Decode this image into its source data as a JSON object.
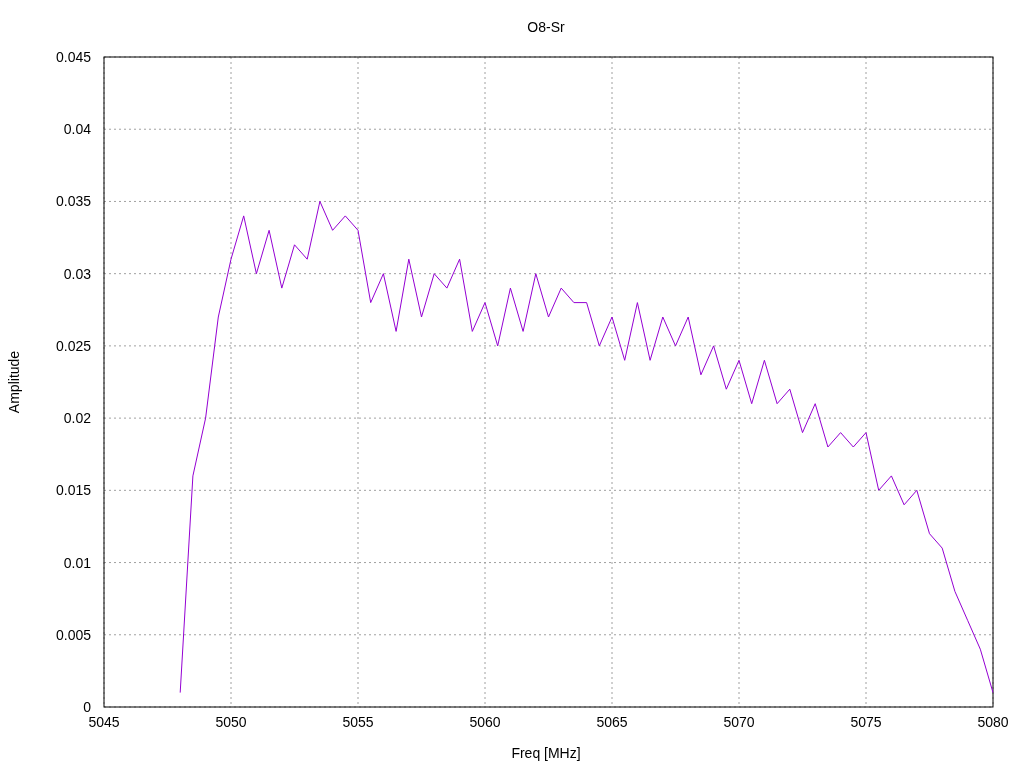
{
  "plot": {
    "chart_data": {
      "type": "line",
      "title": "O8-Sr",
      "xlabel": "Freq [MHz]",
      "ylabel": "Amplitude",
      "grid": true,
      "xlim": [
        5045,
        5080
      ],
      "ylim": [
        0,
        0.045
      ],
      "xticks": [
        5045,
        5050,
        5055,
        5060,
        5065,
        5070,
        5075,
        5080
      ],
      "yticks": [
        0,
        0.005,
        0.01,
        0.015,
        0.02,
        0.025,
        0.03,
        0.035,
        0.04,
        0.045
      ],
      "x": [
        5048,
        5048.5,
        5049,
        5049.5,
        5050,
        5050.5,
        5051,
        5051.5,
        5052,
        5052.5,
        5053,
        5053.5,
        5054,
        5054.5,
        5055,
        5055.5,
        5056,
        5056.5,
        5057,
        5057.5,
        5058,
        5058.5,
        5059,
        5059.5,
        5060,
        5060.5,
        5061,
        5061.5,
        5062,
        5062.5,
        5063,
        5063.5,
        5064,
        5064.5,
        5065,
        5065.5,
        5066,
        5066.5,
        5067,
        5067.5,
        5068,
        5068.5,
        5069,
        5069.5,
        5070,
        5070.5,
        5071,
        5071.5,
        5072,
        5072.5,
        5073,
        5073.5,
        5074,
        5074.5,
        5075,
        5075.5,
        5076,
        5076.5,
        5077,
        5077.5,
        5078,
        5078.5,
        5079,
        5079.5,
        5080
      ],
      "series": [
        {
          "color": "#9400d3",
          "values": [
            0.001,
            0.016,
            0.02,
            0.027,
            0.031,
            0.034,
            0.03,
            0.033,
            0.029,
            0.032,
            0.031,
            0.035,
            0.033,
            0.034,
            0.033,
            0.028,
            0.03,
            0.026,
            0.031,
            0.027,
            0.03,
            0.029,
            0.031,
            0.026,
            0.028,
            0.025,
            0.029,
            0.026,
            0.03,
            0.027,
            0.029,
            0.028,
            0.028,
            0.025,
            0.027,
            0.024,
            0.028,
            0.024,
            0.027,
            0.025,
            0.027,
            0.023,
            0.025,
            0.022,
            0.024,
            0.021,
            0.024,
            0.021,
            0.022,
            0.019,
            0.021,
            0.018,
            0.019,
            0.018,
            0.019,
            0.015,
            0.016,
            0.014,
            0.015,
            0.012,
            0.011,
            0.008,
            0.006,
            0.004,
            0.001
          ]
        }
      ]
    }
  }
}
